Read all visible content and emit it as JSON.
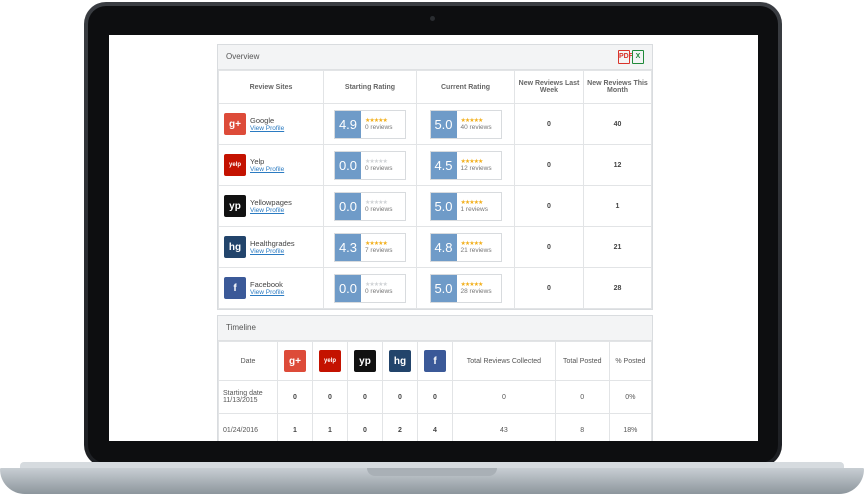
{
  "overview": {
    "title": "Overview",
    "export_pdf": "PDF",
    "export_xls": "X",
    "headers": [
      "Review Sites",
      "Starting Rating",
      "Current Rating",
      "New Reviews Last Week",
      "New Reviews This Month"
    ],
    "view_profile": "View Profile",
    "rows": [
      {
        "site": "Google",
        "logo": "g+",
        "color": "#dd4b39",
        "start": "4.9",
        "start_reviews": "0 reviews",
        "start_stars": "★★★★★",
        "current": "5.0",
        "current_reviews": "40 reviews",
        "current_stars": "★★★★★",
        "last_week": "0",
        "this_month": "40"
      },
      {
        "site": "Yelp",
        "logo": "yelp",
        "color": "#c41200",
        "start": "0.0",
        "start_reviews": "0 reviews",
        "start_stars": "★★★★★",
        "current": "4.5",
        "current_reviews": "12 reviews",
        "current_stars": "★★★★★",
        "last_week": "0",
        "this_month": "12"
      },
      {
        "site": "Yellowpages",
        "logo": "yp",
        "color": "#111111",
        "start": "0.0",
        "start_reviews": "0 reviews",
        "start_stars": "★★★★★",
        "current": "5.0",
        "current_reviews": "1 reviews",
        "current_stars": "★★★★★",
        "last_week": "0",
        "this_month": "1"
      },
      {
        "site": "Healthgrades",
        "logo": "hg",
        "color": "#22446b",
        "start": "4.3",
        "start_reviews": "7 reviews",
        "start_stars": "★★★★★",
        "current": "4.8",
        "current_reviews": "21 reviews",
        "current_stars": "★★★★★",
        "last_week": "0",
        "this_month": "21"
      },
      {
        "site": "Facebook",
        "logo": "f",
        "color": "#3b5998",
        "start": "0.0",
        "start_reviews": "0 reviews",
        "start_stars": "★★★★★",
        "current": "5.0",
        "current_reviews": "28 reviews",
        "current_stars": "★★★★★",
        "last_week": "0",
        "this_month": "28"
      }
    ]
  },
  "timeline": {
    "title": "Timeline",
    "date_header": "Date",
    "logos": [
      {
        "logo": "g+",
        "color": "#dd4b39"
      },
      {
        "logo": "yelp",
        "color": "#c41200"
      },
      {
        "logo": "yp",
        "color": "#111111"
      },
      {
        "logo": "hg",
        "color": "#22446b"
      },
      {
        "logo": "f",
        "color": "#3b5998"
      }
    ],
    "total_collected": "Total Reviews Collected",
    "total_posted": "Total Posted",
    "pct_posted": "% Posted",
    "rows": [
      {
        "date": "Starting date 11/13/2015",
        "values": [
          "0",
          "0",
          "0",
          "0",
          "0"
        ],
        "collected": "0",
        "posted": "0",
        "pct": "0%"
      },
      {
        "date": "01/24/2016",
        "values": [
          "1",
          "1",
          "0",
          "2",
          "4"
        ],
        "collected": "43",
        "posted": "8",
        "pct": "18%"
      }
    ]
  }
}
